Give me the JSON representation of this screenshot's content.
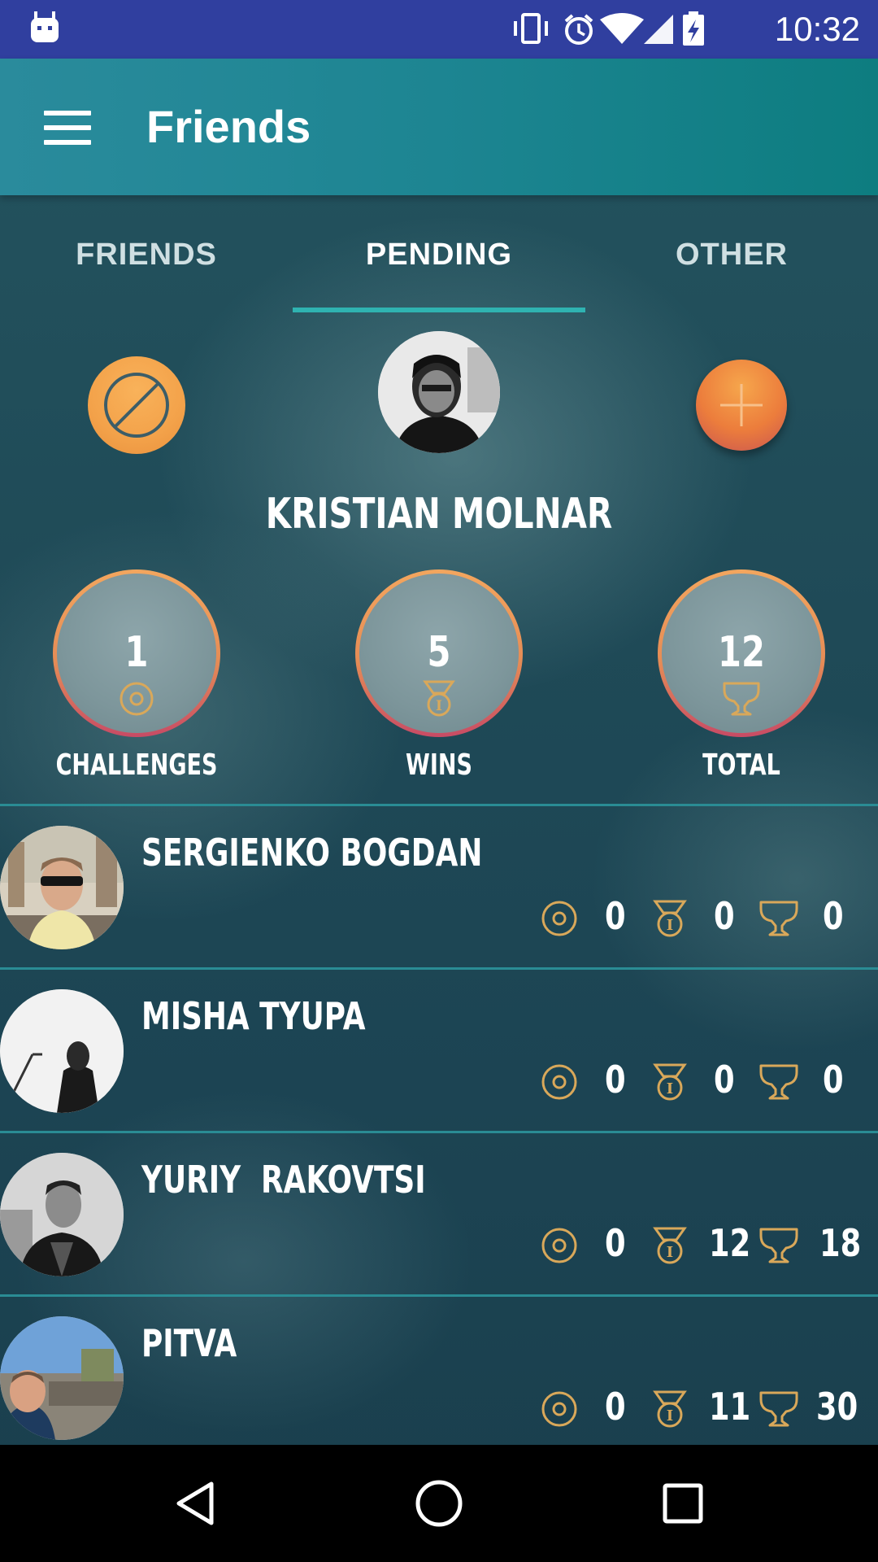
{
  "status_bar": {
    "time": "10:32",
    "icons": [
      "android-icon",
      "vibrate-icon",
      "alarm-icon",
      "wifi-icon",
      "signal-icon",
      "battery-charging-icon"
    ]
  },
  "app_bar": {
    "title": "Friends",
    "menu_icon": "hamburger-menu-icon"
  },
  "tabs": [
    {
      "label": "FRIENDS",
      "active": false
    },
    {
      "label": "PENDING",
      "active": true
    },
    {
      "label": "OTHER",
      "active": false
    }
  ],
  "profile": {
    "name": "KRISTIAN MOLNAR",
    "left_button_icon": "block-icon",
    "right_button_icon": "plus-icon",
    "stats": [
      {
        "value": "1",
        "label": "CHALLENGES",
        "icon": "target-icon"
      },
      {
        "value": "5",
        "label": "WINS",
        "icon": "medal-icon"
      },
      {
        "value": "12",
        "label": "TOTAL",
        "icon": "trophy-icon"
      }
    ]
  },
  "friends": [
    {
      "name": "SERGIENKO BOGDAN",
      "challenges": "0",
      "wins": "0",
      "total": "0"
    },
    {
      "name": "MISHA TYUPA",
      "challenges": "0",
      "wins": "0",
      "total": "0"
    },
    {
      "name": "YURIY  RAKOVTSI",
      "challenges": "0",
      "wins": "12",
      "total": "18"
    },
    {
      "name": "PITVA",
      "challenges": "0",
      "wins": "11",
      "total": "30"
    }
  ],
  "nav_bar": {
    "buttons": [
      "back-icon",
      "home-icon",
      "recents-icon"
    ]
  },
  "colors": {
    "status_bar": "#303f9f",
    "app_bar": "#1d8592",
    "accent": "#2fb3b1",
    "orange": "#f3a24a",
    "icon_gold": "#d9a85a"
  }
}
